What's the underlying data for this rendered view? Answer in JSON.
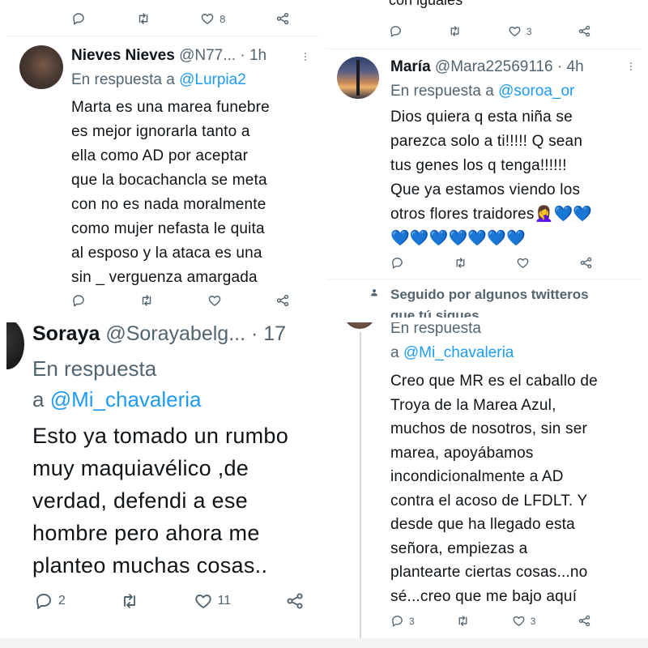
{
  "panel1": {
    "top_actions": {
      "likes": "8"
    },
    "tweet": {
      "name": "Nieves Nieves",
      "handle": "@N77...",
      "dot": "·",
      "time": "1h",
      "reply_prefix": "En respuesta a",
      "reply_to": "@Lurpia2",
      "text": "Marta es una marea funebre\nes mejor ignorarla tanto a\nella como AD por aceptar\nque la bocachancla se meta\ncon  no es nada moralmente\ncomo mujer nefasta le quita\nal esposo y la ataca es una\nsin _ verguenza amargada"
    }
  },
  "panel2": {
    "top_text": "con iguales",
    "top_actions": {
      "likes": "3"
    },
    "tweet": {
      "name": "María",
      "handle": "@Mara22569116",
      "dot": "·",
      "time": "4h",
      "reply_prefix": "En respuesta a",
      "reply_to": "@soroa_or",
      "text": "Dios quiera q esta niña se\nparezca solo a ti!!!!! Q sean\ntus genes los q tenga!!!!!!\nQue ya estamos viendo los\notros flores traidores",
      "emoji_line1": "🤦‍♀️💙💙",
      "emoji_line2": "💙💙💙💙💙💙💙"
    },
    "followed_by": "Seguido por algunos twitteros",
    "followed_by_2": "que tú sigues"
  },
  "panel3": {
    "tweet": {
      "name": "Soraya",
      "handle": "@Sorayabelg...",
      "dot": "·",
      "time": "17",
      "reply_prefix": "En respuesta",
      "reply_a": "a",
      "reply_to": "@Mi_chavaleria",
      "text": "Esto ya tomado un rumbo\nmuy maquiavélico ,de\nverdad, defendi a ese\nhombre pero ahora me\nplanteo muchas cosas..",
      "replies": "2",
      "likes": "11"
    }
  },
  "panel4": {
    "tweet": {
      "reply_prefix": "En respuesta",
      "reply_a": "a",
      "reply_to": "@Mi_chavaleria",
      "text": "Creo que MR es el caballo de\nTroya de la Marea Azul,\nmuchos de nosotros, sin ser\nmarea, apoyábamos\nincondicionalmente a AD\ncontra el acoso de LFDLT. Y\ndesde que ha llegado esta\nseñora, empiezas a\nplantearte ciertas cosas...no\nsé...creo que me bajo aquí",
      "replies": "3",
      "likes": "3"
    }
  },
  "colors": {
    "link": "#1d9bf0",
    "text": "#0f1419",
    "secondary": "#536471",
    "heart_blue": "#4aa8f0"
  }
}
